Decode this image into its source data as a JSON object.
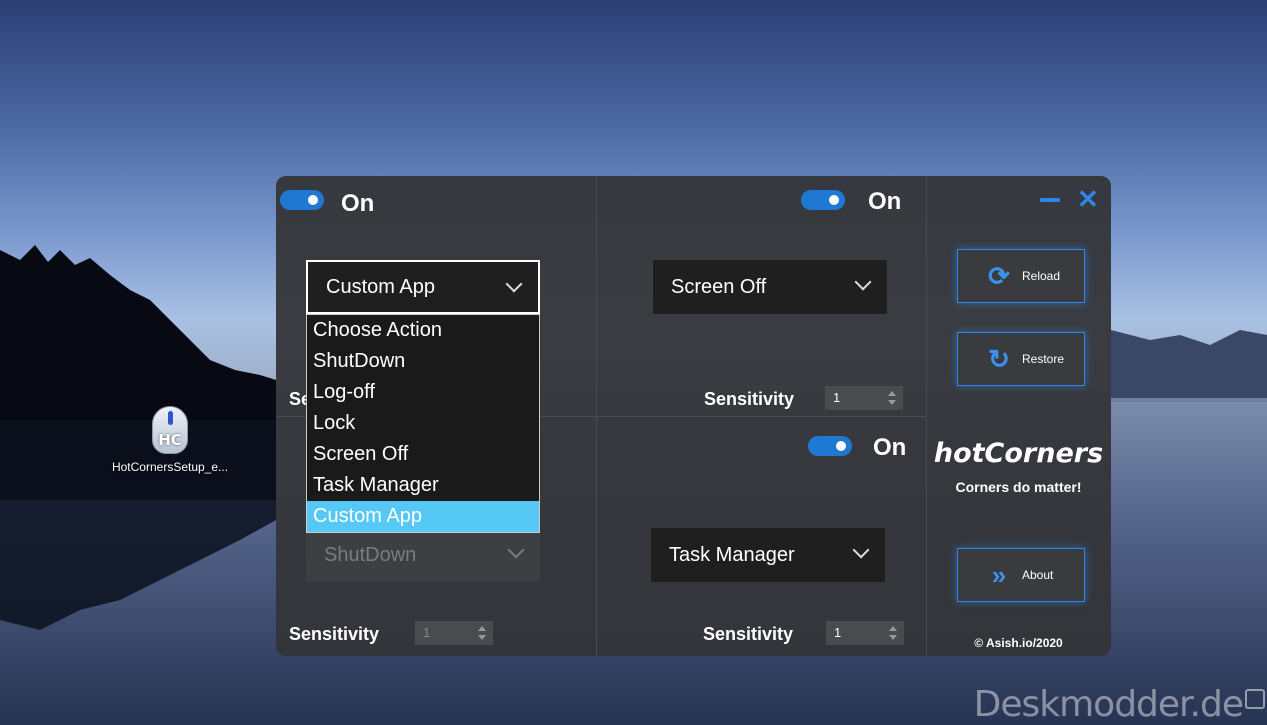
{
  "desktop": {
    "icon_label": "HotCornersSetup_e...",
    "icon_glyph": "HC",
    "watermark": "Deskmodder.de"
  },
  "corners": {
    "top_left": {
      "toggle_label": "On",
      "action": "Custom App",
      "sensitivity_label": "Se"
    },
    "top_right": {
      "toggle_label": "On",
      "action": "Screen Off",
      "sensitivity_label": "Sensitivity",
      "sensitivity_value": "1"
    },
    "bottom_left": {
      "action": "ShutDown",
      "sensitivity_label": "Sensitivity",
      "sensitivity_value": "1"
    },
    "bottom_right": {
      "toggle_label": "On",
      "action": "Task Manager",
      "sensitivity_label": "Sensitivity",
      "sensitivity_value": "1"
    }
  },
  "dropdown": {
    "options": [
      "Choose Action",
      "ShutDown",
      "Log-off",
      "Lock",
      "Screen Off",
      "Task Manager",
      "Custom App"
    ],
    "selected": "Custom App"
  },
  "sidebar": {
    "reload_label": "Reload",
    "restore_label": "Restore",
    "about_label": "About",
    "brand_title": "hotCorners",
    "brand_tagline": "Corners do matter!",
    "copyright": "© Asish.io/2020"
  },
  "colors": {
    "accent": "#2e86e8",
    "toggle": "#1f78d1",
    "selected_option": "#55c8f5"
  }
}
